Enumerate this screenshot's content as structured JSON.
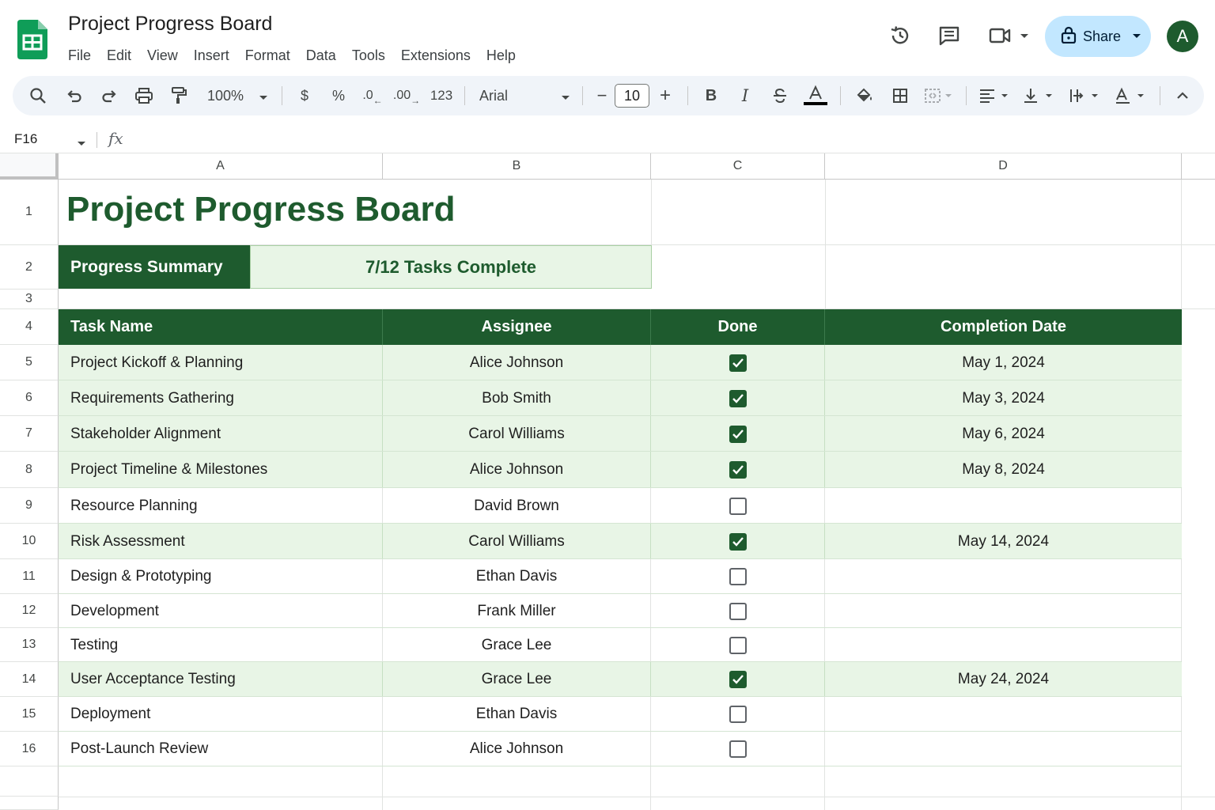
{
  "app": {
    "title": "Project Progress Board",
    "menu": [
      "File",
      "Edit",
      "View",
      "Insert",
      "Format",
      "Data",
      "Tools",
      "Extensions",
      "Help"
    ],
    "share_label": "Share",
    "avatar_initial": "A",
    "brand_color": "#1e5b2e",
    "icons": [
      "sheets-logo-icon",
      "history-icon",
      "comments-icon",
      "meet-icon",
      "lock-icon",
      "chevron-down-icon"
    ]
  },
  "toolbar": {
    "zoom": "100%",
    "currency": "$",
    "percent": "%",
    "decrease_decimal": ".0",
    "increase_decimal": ".00",
    "format_123": "123",
    "font": "Arial",
    "font_size": "10",
    "minus": "−",
    "plus": "+",
    "bold": "B",
    "italic": "I"
  },
  "formula_bar": {
    "cell_ref": "F16",
    "fx": "fx",
    "value": ""
  },
  "columns": [
    "A",
    "B",
    "C",
    "D"
  ],
  "row_numbers": [
    "1",
    "2",
    "3",
    "4",
    "5",
    "6",
    "7",
    "8",
    "9",
    "10",
    "11",
    "12",
    "13",
    "14",
    "15",
    "16"
  ],
  "sheet": {
    "title": "Project Progress Board",
    "summary_label": "Progress Summary",
    "summary_value": "7/12 Tasks Complete",
    "headers": [
      "Task Name",
      "Assignee",
      "Done",
      "Completion Date"
    ],
    "tasks": [
      {
        "task": "Project Kickoff & Planning",
        "assignee": "Alice Johnson",
        "done": true,
        "date": "May 1, 2024"
      },
      {
        "task": "Requirements Gathering",
        "assignee": "Bob Smith",
        "done": true,
        "date": "May 3, 2024"
      },
      {
        "task": "Stakeholder Alignment",
        "assignee": "Carol Williams",
        "done": true,
        "date": "May 6, 2024"
      },
      {
        "task": "Project Timeline & Milestones",
        "assignee": "Alice Johnson",
        "done": true,
        "date": "May 8, 2024"
      },
      {
        "task": "Resource Planning",
        "assignee": "David Brown",
        "done": false,
        "date": ""
      },
      {
        "task": "Risk Assessment",
        "assignee": "Carol Williams",
        "done": true,
        "date": "May 14, 2024"
      },
      {
        "task": "Design & Prototyping",
        "assignee": "Ethan Davis",
        "done": false,
        "date": ""
      },
      {
        "task": "Development",
        "assignee": "Frank Miller",
        "done": false,
        "date": ""
      },
      {
        "task": "Testing",
        "assignee": "Grace Lee",
        "done": false,
        "date": ""
      },
      {
        "task": "User Acceptance Testing",
        "assignee": "Grace Lee",
        "done": true,
        "date": "May 24, 2024"
      },
      {
        "task": "Deployment",
        "assignee": "Ethan Davis",
        "done": false,
        "date": ""
      },
      {
        "task": "Post-Launch Review",
        "assignee": "Alice Johnson",
        "done": false,
        "date": ""
      }
    ]
  }
}
